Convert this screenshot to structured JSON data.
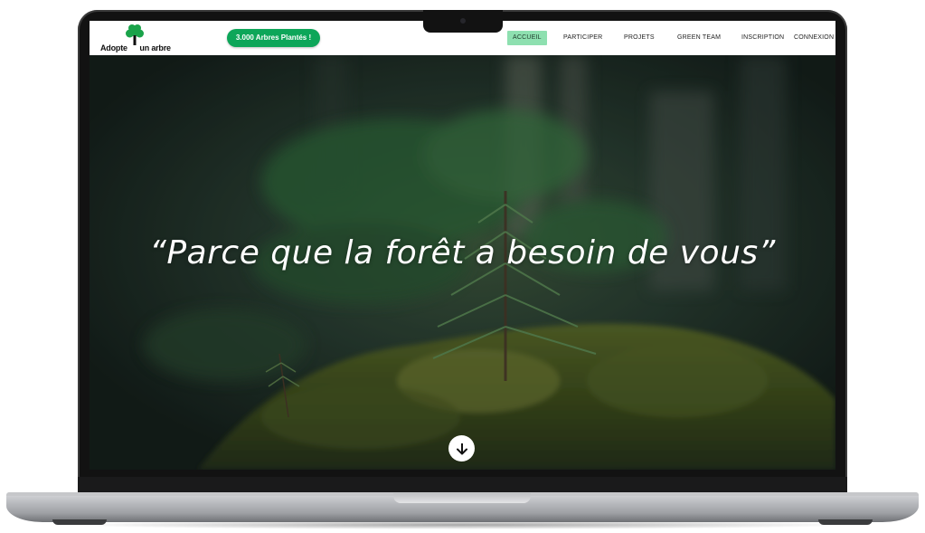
{
  "header": {
    "logo": {
      "text_part1": "Adopte",
      "text_part2": "un arbre",
      "icon": "tree-icon",
      "color": "#1aa34a"
    },
    "counter_button": "3.000 Arbres Plantés !",
    "nav": [
      {
        "label": "ACCUEIL",
        "active": true
      },
      {
        "label": "PARTICIPER",
        "active": false
      },
      {
        "label": "PROJETS",
        "active": false
      },
      {
        "label": "GREEN TEAM",
        "active": false
      },
      {
        "label": "INSCRIPTION",
        "active": false
      },
      {
        "label": "CONNEXION",
        "active": false
      }
    ]
  },
  "hero": {
    "quote": "“Parce que la forêt a besoin de vous”",
    "scroll_icon": "arrow-down-icon"
  },
  "colors": {
    "accent_green": "#0da659",
    "active_nav_bg": "#8ee0b0",
    "hero_dark": "#1c2b25"
  }
}
